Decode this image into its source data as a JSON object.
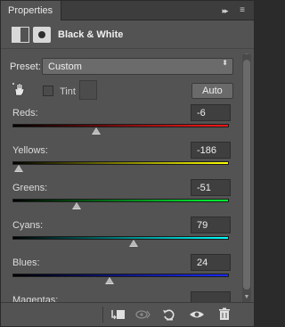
{
  "panel": {
    "tab_label": "Properties",
    "collapse_glyph": "▸▸",
    "menu_glyph": "≡",
    "adjustment_title": "Black & White"
  },
  "preset": {
    "label": "Preset:",
    "value": "Custom",
    "arrow_glyph": "⬍"
  },
  "tint": {
    "label": "Tint",
    "checked": false
  },
  "auto_label": "Auto",
  "sliders": [
    {
      "id": "reds",
      "label": "Reds:",
      "value": "-6",
      "min": -200,
      "max": 300,
      "numeric": -6
    },
    {
      "id": "yellows",
      "label": "Yellows:",
      "value": "-186",
      "min": -200,
      "max": 300,
      "numeric": -186
    },
    {
      "id": "greens",
      "label": "Greens:",
      "value": "-51",
      "min": -200,
      "max": 300,
      "numeric": -51
    },
    {
      "id": "cyans",
      "label": "Cyans:",
      "value": "79",
      "min": -200,
      "max": 300,
      "numeric": 79
    },
    {
      "id": "blues",
      "label": "Blues:",
      "value": "24",
      "min": -200,
      "max": 300,
      "numeric": 24
    },
    {
      "id": "magentas",
      "label": "Magentas:",
      "value": "",
      "min": -200,
      "max": 300,
      "numeric": null
    }
  ],
  "toolbar": {
    "clip_icon": "clip-to-layer-icon",
    "view_previous_icon": "view-previous-state-icon",
    "reset_icon": "reset-icon",
    "visibility_icon": "eye-icon",
    "delete_icon": "trash-icon"
  },
  "colors": {
    "panel_bg": "#535353",
    "tab_bar_bg": "#3d3d3d",
    "input_bg": "#3f3f3f"
  }
}
